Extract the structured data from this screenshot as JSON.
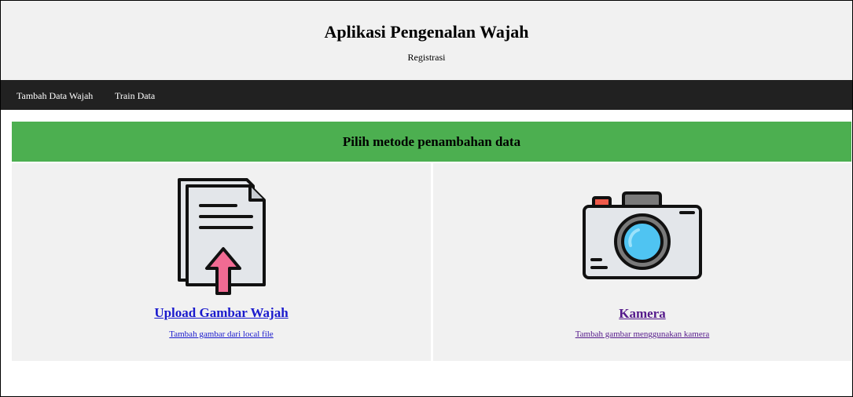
{
  "header": {
    "title": "Aplikasi Pengenalan Wajah",
    "subtitle": "Registrasi"
  },
  "nav": {
    "items": [
      {
        "label": "Tambah Data Wajah"
      },
      {
        "label": "Train Data"
      }
    ]
  },
  "banner": {
    "title": "Pilih metode penambahan data"
  },
  "options": [
    {
      "icon": "file-upload-icon",
      "title": "Upload Gambar Wajah",
      "description": "Tambah gambar dari local file"
    },
    {
      "icon": "camera-icon",
      "title": "Kamera",
      "description": "Tambah gambar menggunakan kamera"
    }
  ],
  "colors": {
    "header_bg": "#f1f1f1",
    "nav_bg": "#212121",
    "banner_bg": "#4caf50",
    "link": "#1a1acd",
    "visited_link": "#551a8b"
  }
}
